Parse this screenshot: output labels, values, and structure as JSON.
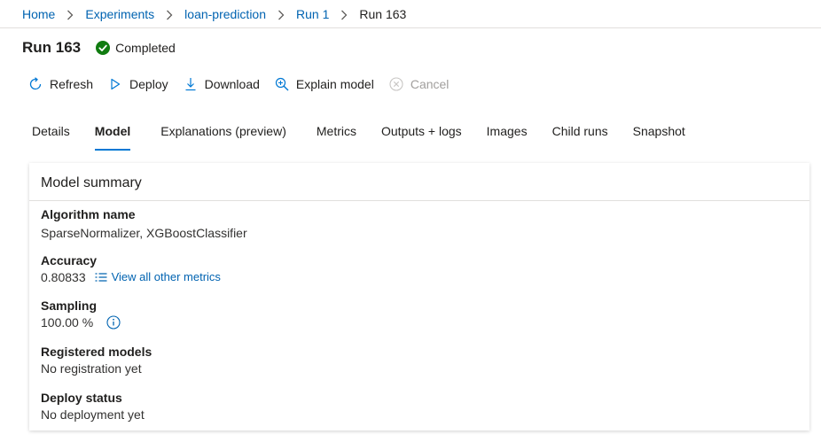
{
  "breadcrumb": {
    "items": [
      "Home",
      "Experiments",
      "loan-prediction",
      "Run 1"
    ],
    "current": "Run 163"
  },
  "header": {
    "title": "Run 163",
    "status": "Completed",
    "status_color": "#107c10"
  },
  "toolbar": {
    "refresh_label": "Refresh",
    "deploy_label": "Deploy",
    "download_label": "Download",
    "explain_label": "Explain model",
    "cancel_label": "Cancel",
    "icons": [
      "refresh-icon",
      "play-icon",
      "download-icon",
      "search-plus-icon",
      "cancel-icon"
    ]
  },
  "tabs": [
    {
      "label": "Details"
    },
    {
      "label": "Model",
      "active": true
    },
    {
      "label": "Explanations (preview)"
    },
    {
      "label": "Metrics"
    },
    {
      "label": "Outputs + logs"
    },
    {
      "label": "Images"
    },
    {
      "label": "Child runs"
    },
    {
      "label": "Snapshot"
    }
  ],
  "summary": {
    "title": "Model summary",
    "algorithm_label": "Algorithm name",
    "algorithm_value": "SparseNormalizer, XGBoostClassifier",
    "accuracy_label": "Accuracy",
    "accuracy_value": "0.80833",
    "metrics_link": "View all other metrics",
    "sampling_label": "Sampling",
    "sampling_value": "100.00 %",
    "registered_label": "Registered models",
    "registered_value": "No registration yet",
    "deploy_label": "Deploy status",
    "deploy_value": "No deployment yet"
  },
  "colors": {
    "accent": "#0078d4",
    "link": "#0063b1",
    "disabled": "#a19f9d"
  }
}
